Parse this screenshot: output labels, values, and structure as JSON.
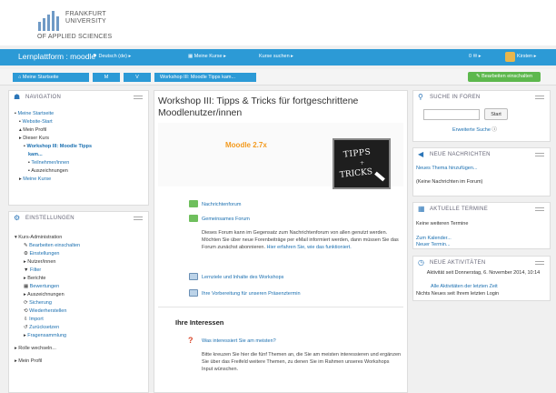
{
  "brand": {
    "line1": "FRANKFURT",
    "line2": "UNIVERSITY",
    "line3": "OF APPLIED SCIENCES"
  },
  "navbar": {
    "title": "Lernplattform : moodle",
    "menu": [
      "Deutsch (de) ▸",
      "Meine Kurse ▸",
      "Kurse suchen ▸"
    ],
    "messages": "0 ✉ ▸",
    "user": "Kirsten ▸"
  },
  "breadcrumb": [
    "Meine Startseite",
    "M",
    "V",
    "Workshop III: Moodle Tipps kam..."
  ],
  "edit_button": "Bearbeiten einschalten",
  "navigation": {
    "title": "NAVIGATION",
    "items": [
      "Meine Startseite",
      "Website-Start",
      "Mein Profil",
      "Dieser Kurs",
      "Workshop III: Moodle Tipps",
      "kam...",
      "Teilnehmer/innen",
      "Auszeichnungen",
      "Meine Kurse"
    ]
  },
  "settings": {
    "title": "EINSTELLUNGEN",
    "items": [
      "Kurs-Administration",
      "Bearbeiten einschalten",
      "Einstellungen",
      "Nutzer/innen",
      "Filter",
      "Berichte",
      "Bewertungen",
      "Auszeichnungen",
      "Sicherung",
      "Wiederherstellen",
      "Import",
      "Zurücksetzen",
      "Fragensammlung",
      "Rolle wechseln...",
      "Mein Profil"
    ]
  },
  "main": {
    "title": "Workshop III: Tipps & Tricks für fortgeschrittene Moodlenutzer/innen",
    "moodle_version": "Moodle 2.7x",
    "image_text": {
      "t1": "TIPPS",
      "t2": "+",
      "t3": "TRICKS"
    },
    "links": {
      "news": "Nachrichtenforum",
      "forum": "Gemeinsames Forum",
      "goals": "Lernziele und Inhalte des Workshops",
      "prep": "Ihre Vorbereitung für unseren Präsenztermin"
    },
    "forum_desc": "Dieses Forum kann im Gegensatz zum Nachrichtenforum von allen genutzt werden. Möchten Sie über neue Forenbeiträge per eMail informiert werden, dann müssen Sie das Forum zunächst abonnieren.",
    "forum_desc_link": "Hier erfahren Sie, wie das funktioniert.",
    "section_title": "Ihre Interessen",
    "question_link": "Was interessiert Sie am meisten?",
    "question_desc": "Bitte kreuzen Sie hier die fünf Themen an, die Sie am meisten interessieren und ergänzen Sie über das Freifeld weitere Themen, zu denen Sie im Rahmen unseres Workshops Input wünschen."
  },
  "search": {
    "title": "SUCHE IN FOREN",
    "button": "Start",
    "advanced": "Erweiterte Suche"
  },
  "news": {
    "title": "NEUE NACHRICHTEN",
    "add": "Neues Thema hinzufügen...",
    "empty": "(Keine Nachrichten im Forum)"
  },
  "events": {
    "title": "AKTUELLE TERMINE",
    "empty": "Keine weiteren Termine",
    "calendar": "Zum Kalender...",
    "new": "Neuer Termin..."
  },
  "activity": {
    "title": "NEUE AKTIVITÄTEN",
    "since": "Aktivität seit Donnerstag, 6. November 2014, 10:14",
    "report": "Alle Aktivitäten der letzten Zeit",
    "none": "Nichts Neues seit Ihrem letzten Login"
  },
  "colors": {
    "navbar": "#2c9ad6",
    "edit_button": "#5db84d",
    "moodle_label": "#f39a1e"
  }
}
